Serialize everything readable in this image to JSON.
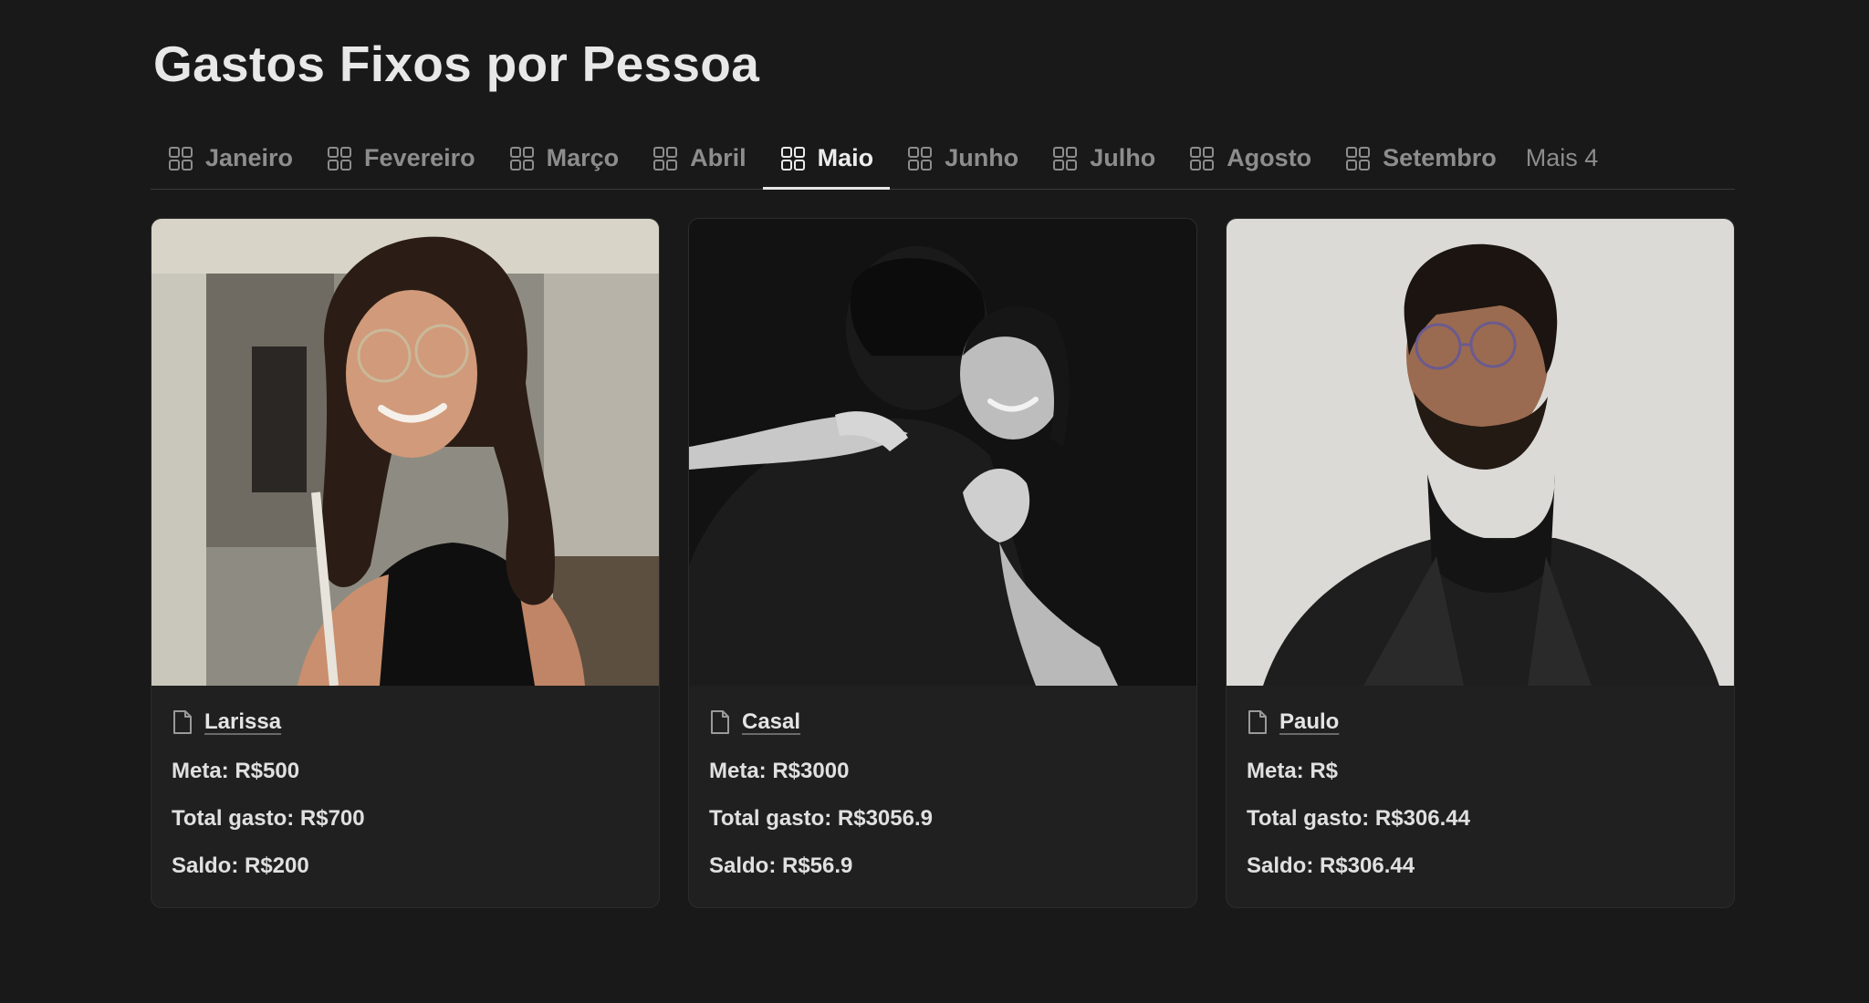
{
  "page": {
    "title": "Gastos Fixos por Pessoa"
  },
  "tabs": [
    {
      "label": "Janeiro",
      "active": false
    },
    {
      "label": "Fevereiro",
      "active": false
    },
    {
      "label": "Março",
      "active": false
    },
    {
      "label": "Abril",
      "active": false
    },
    {
      "label": "Maio",
      "active": true
    },
    {
      "label": "Junho",
      "active": false
    },
    {
      "label": "Julho",
      "active": false
    },
    {
      "label": "Agosto",
      "active": false
    },
    {
      "label": "Setembro",
      "active": false
    }
  ],
  "more_tabs_label": "Mais 4",
  "cards": [
    {
      "name": "Larissa",
      "meta": "Meta: R$500",
      "total": "Total gasto: R$700",
      "saldo": "Saldo: R$200",
      "photo_icon": "woman-portrait-photo"
    },
    {
      "name": "Casal",
      "meta": "Meta: R$3000",
      "total": "Total gasto: R$3056.9",
      "saldo": "Saldo: R$56.9",
      "photo_icon": "couple-hug-photo"
    },
    {
      "name": "Paulo",
      "meta": "Meta: R$",
      "total": "Total gasto: R$306.44",
      "saldo": "Saldo: R$306.44",
      "photo_icon": "man-portrait-photo"
    }
  ],
  "icons": {
    "tab_icon": "gallery-grid-icon",
    "card_icon": "page-document-icon"
  },
  "colors": {
    "background": "#191919",
    "card": "#202020",
    "text": "#e0e0e0",
    "muted": "#8d8d8d"
  }
}
